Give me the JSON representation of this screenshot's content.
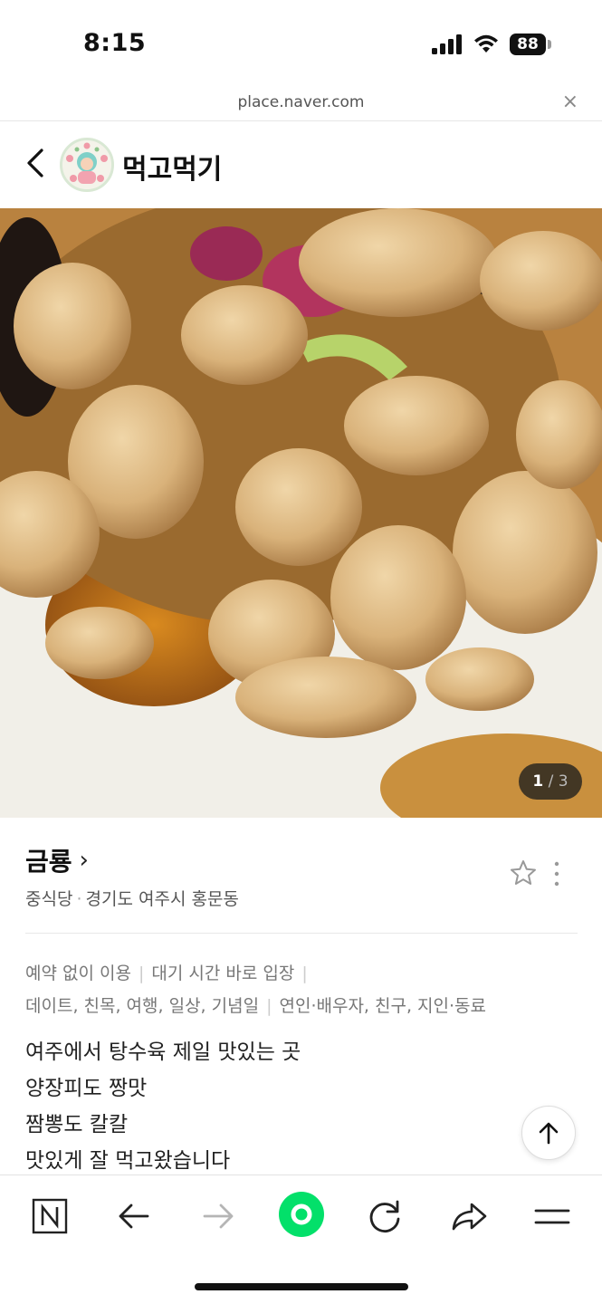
{
  "status_bar": {
    "time": "8:15",
    "battery": "88",
    "icons": [
      "signal-icon",
      "wifi-icon",
      "battery-icon"
    ]
  },
  "url_bar": {
    "url": "place.naver.com",
    "close_label": "×"
  },
  "header": {
    "channel_name": "먹고먹기",
    "back_icon": "chevron-left-icon"
  },
  "photo": {
    "current": "1",
    "separator": "/",
    "total": "3"
  },
  "place": {
    "name": "금룡",
    "name_chevron": "›",
    "category": "중식당",
    "meta_separator": "·",
    "address": "경기도 여주시 홍문동",
    "star_icon": "star-outline-icon",
    "more_icon": "more-vertical-icon"
  },
  "tags": {
    "line1": [
      "예약 없이 이용",
      "대기 시간 바로 입장"
    ],
    "line2": [
      "데이트, 친목, 여행, 일상, 기념일",
      "연인·배우자, 친구, 지인·동료"
    ],
    "separator": "|"
  },
  "review": {
    "lines": [
      "여주에서 탕수육 제일 맛있는 곳",
      "양장피도 짱맛",
      "짬뽕도 칼칼",
      "맛있게 잘 먹고왔습니다"
    ]
  },
  "toolbar": {
    "icons": [
      "naver-n-icon",
      "arrow-left-icon",
      "arrow-right-icon",
      "green-dot-icon",
      "refresh-icon",
      "share-icon",
      "menu-icon"
    ]
  },
  "colors": {
    "naver_green": "#03e06a",
    "counter_bg": "#1e1e1e"
  }
}
